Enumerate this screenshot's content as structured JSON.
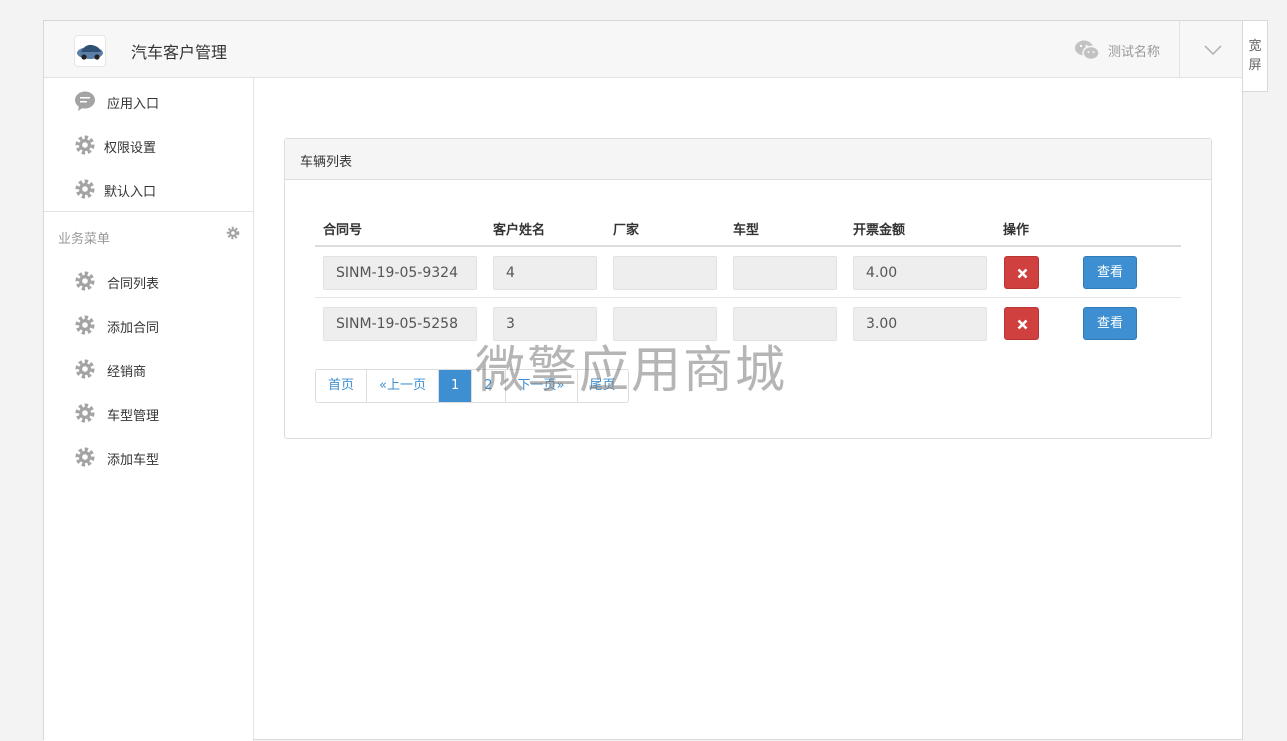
{
  "header": {
    "app_title": "汽车客户管理",
    "account_name": "测试名称",
    "wide_label_1": "宽",
    "wide_label_2": "屏"
  },
  "sidebar": {
    "top_items": [
      {
        "label": "应用入口",
        "icon": "chat-bubble-icon"
      },
      {
        "label": "权限设置",
        "icon": "gear-icon"
      },
      {
        "label": "默认入口",
        "icon": "gear-icon"
      }
    ],
    "section_label": "业务菜单",
    "business_items": [
      {
        "label": "合同列表",
        "icon": "gear-icon"
      },
      {
        "label": "添加合同",
        "icon": "gear-icon"
      },
      {
        "label": "经销商",
        "icon": "gear-icon"
      },
      {
        "label": "车型管理",
        "icon": "gear-icon"
      },
      {
        "label": "添加车型",
        "icon": "gear-icon"
      }
    ]
  },
  "panel": {
    "title": "车辆列表",
    "columns": [
      "合同号",
      "客户姓名",
      "厂家",
      "车型",
      "开票金额",
      "操作"
    ],
    "rows": [
      {
        "contract": "SINM-19-05-9324",
        "customer": "4",
        "maker": "",
        "model": "",
        "amount": "4.00"
      },
      {
        "contract": "SINM-19-05-5258",
        "customer": "3",
        "maker": "",
        "model": "",
        "amount": "3.00"
      }
    ],
    "view_label": "查看",
    "pager": {
      "first": "首页",
      "prev": "«上一页",
      "pages": [
        "1",
        "2"
      ],
      "current": "1",
      "next": "下一页»",
      "last": "尾页"
    }
  },
  "watermark": "微擎应用商城",
  "colors": {
    "primary": "#3d8fd1",
    "danger": "#d0403f",
    "icon_gray": "#a3a3a3"
  }
}
